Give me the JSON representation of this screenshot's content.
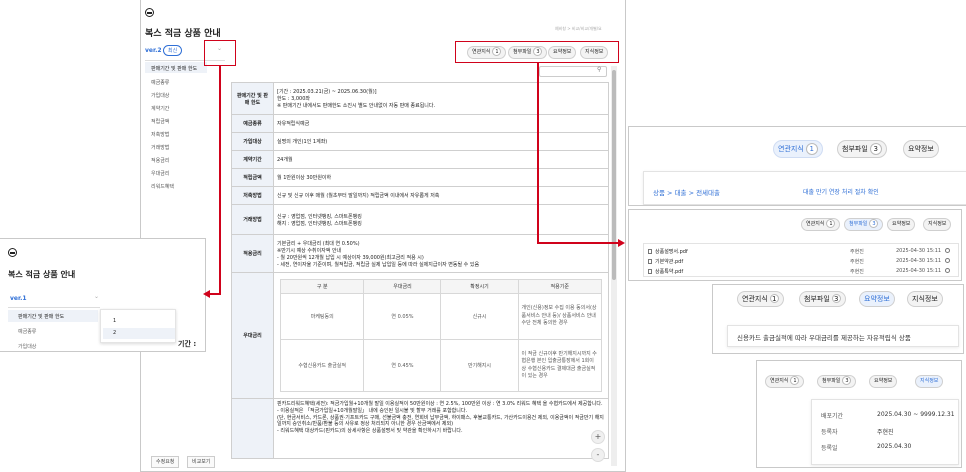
{
  "main": {
    "title": "복스 적금 상품 안내",
    "breadcrumb": "예비창 > 비교/비교/개별/요",
    "version_label": "ver.2",
    "latest_badge": "최신",
    "tabs": [
      {
        "label": "연관지식",
        "count": "1"
      },
      {
        "label": "첨부파일",
        "count": "3"
      },
      {
        "label": "요약정보",
        "count": ""
      },
      {
        "label": "지식정보",
        "count": ""
      }
    ],
    "sidebar": [
      "판매기간 및 판매 한도",
      "예금종류",
      "가입대상",
      "계약기간",
      "적립금액",
      "저축방법",
      "거래방법",
      "적용금리",
      "우대금리",
      "리워드혜택"
    ],
    "spec": [
      {
        "k": "판매기간 및 판매 한도",
        "v": "[기간 : 2025.03.21(금) ~ 2025.06.30(월)]\n한도 : 3,000좌\n※ 판매기간 내에서도 판매한도 소진시 별도 안내없이 자동 판매 종료됩니다."
      },
      {
        "k": "예금종류",
        "v": "자유적립식예금"
      },
      {
        "k": "가입대상",
        "v": "실명의 개인(1인 1계좌)"
      },
      {
        "k": "계약기간",
        "v": "24개월"
      },
      {
        "k": "적립금액",
        "v": "월 1만원이상 30만원이하"
      },
      {
        "k": "저축방법",
        "v": "신규 및 신규 이후 매월 (월초부터 말일까지) 적립금액 이내에서 자유롭게 저축"
      },
      {
        "k": "거래방법",
        "v": "신규 : 영업점, 인터넷뱅킹, 스마트폰뱅킹\n해지 : 영업점, 인터넷뱅킹, 스마트폰뱅킹"
      },
      {
        "k": "적용금리",
        "v": "기본금리 + 우대금리 (최대 연 0.50%)\n※만기시 예상 수취이자액 안내\n- 월 20만원씩 12개월 납입 시 예상이자 39,000원(최고금리 적용 시)\n- 세전, 연이자율 기준이며, 월적립금, 적립금 실제 납입일 등에 따라 실제지급이자 변동될 수 있음"
      }
    ],
    "pref_key": "우대금리",
    "pref_head": [
      "구 분",
      "우대금리",
      "확정시기",
      "적용기준"
    ],
    "pref_rows": [
      [
        "마케팅동의",
        "연 0.05%",
        "신규시",
        "개인(신용)정보 수집 이용 동의서(상품서비스 안내 등)/ 상품서비스 안내 수단 전체 동의한 경우"
      ],
      [
        "수협신용카드 출금실적",
        "연 0.45%",
        "만기해지시",
        "이 적금 신규이후 만기해지시까지 수협은행 본인 입출금통장에서 1회이상 수협신용카드 결제대금 출금실적이 있는 경우"
      ]
    ],
    "reward_text": "핀카드리워드혜택(세전): 적금가입월+10개월 말일 이용실적이 50만원이상 : 연 2.5%, 100만원 이상 : 연 3.0% 리워드 혜택 을 수협카드에서 제공합니다.\n- 이용실적은 「적금가입일+10개월말일」 내에 승인된 일시불 및 할부 거래를 포함합니다.\n(단, 현금서비스, 카드론, 상품권·기프트카드 구매, 선불금액 충전, 연회비 납부금액, 하이패스, 후불교통카드, 가산카드이용건 제외, 이용금액이 적금만기 해지일까지 승인취소/반품/환불 등의 사유로 정상 처리되지 아니한 경우 산금액에서 제외)\n- 리워드혜택 대상카드(핀카드)의 상세사항은 상품설명서 및 약관을 확인하시기 바랍니다.",
    "buttons": {
      "edit": "수정요청",
      "compare": "비교보기"
    },
    "zoom": {
      "plus": "+",
      "minus": "-"
    }
  },
  "left": {
    "title": "복스 적금 상품 안내",
    "version_label": "ver.1",
    "sidebar": [
      "판매기간 및 판매 한도",
      "예금종류",
      "가입대상"
    ],
    "options": [
      "1",
      "2"
    ],
    "peek": "기간 :"
  },
  "related": {
    "tabs": [
      {
        "label": "연관지식",
        "count": "1"
      },
      {
        "label": "첨부파일",
        "count": "3"
      },
      {
        "label": "요약정보",
        "count": ""
      }
    ],
    "path": "상품 > 대출 > 전세대출",
    "link": "대출 만기 연장 처리 절차 확인"
  },
  "attach": {
    "tabs": [
      {
        "label": "연관지식",
        "count": "1"
      },
      {
        "label": "첨부파일",
        "count": "3"
      },
      {
        "label": "요약정보",
        "count": ""
      },
      {
        "label": "지식정보",
        "count": ""
      }
    ],
    "files": [
      {
        "name": "상품설명서.pdf",
        "author": "주현진",
        "date": "2025-04-30 15:11"
      },
      {
        "name": "기본약관.pdf",
        "author": "주현진",
        "date": "2025-04-30 15:11"
      },
      {
        "name": "상품특약.pdf",
        "author": "주현진",
        "date": "2025-04-30 15:11"
      }
    ]
  },
  "summary": {
    "tabs": [
      {
        "label": "연관지식",
        "count": "1"
      },
      {
        "label": "첨부파일",
        "count": "3"
      },
      {
        "label": "요약정보",
        "count": ""
      },
      {
        "label": "지식정보",
        "count": ""
      }
    ],
    "text": "신용카드 출금실적에 따라 우대금리를 제공하는 자유적립식 상품"
  },
  "info": {
    "tabs": [
      {
        "label": "연관지식",
        "count": "1"
      },
      {
        "label": "첨부파일",
        "count": "3"
      },
      {
        "label": "요약정보",
        "count": ""
      },
      {
        "label": "지식정보",
        "count": ""
      }
    ],
    "rows": [
      {
        "k": "배포기간",
        "v": "2025.04.30 ~ 9999.12.31"
      },
      {
        "k": "등록자",
        "v": "주현진"
      },
      {
        "k": "등록일",
        "v": "2025.04.30"
      }
    ]
  },
  "colors": {
    "accent": "#2f6fd6",
    "annotation": "#d0021b",
    "header_bg": "#eef2f8"
  }
}
